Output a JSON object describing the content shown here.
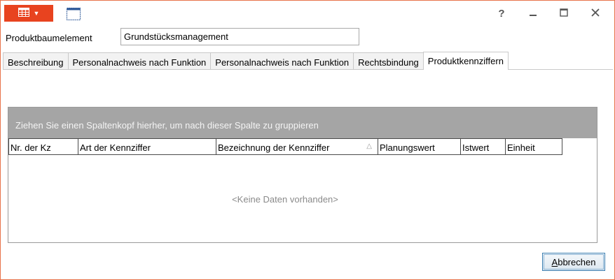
{
  "window": {
    "help_label": "?",
    "accent_color": "#e8431f"
  },
  "icons": {
    "app_menu": "grid-icon",
    "app_menu_caret": "caret-down-icon",
    "layout": "window-layout-icon",
    "minimize": "minimize-icon",
    "maximize": "maximize-icon",
    "close": "close-icon",
    "sort": "sort-ascending-icon"
  },
  "field": {
    "label": "Produktbaumelement",
    "value": "Grundstücksmanagement"
  },
  "tabs": [
    {
      "label": "Beschreibung",
      "active": false
    },
    {
      "label": "Personalnachweis nach Funktion",
      "active": false
    },
    {
      "label": "Personalnachweis nach Funktion",
      "active": false
    },
    {
      "label": "Rechtsbindung",
      "active": false
    },
    {
      "label": "Produktkennziffern",
      "active": true
    }
  ],
  "grid": {
    "group_panel_text": "Ziehen Sie einen Spaltenkopf hierher, um nach dieser Spalte zu gruppieren",
    "columns": [
      {
        "label": "Nr. der Kz"
      },
      {
        "label": "Art der Kennziffer"
      },
      {
        "label": "Bezeichnung der Kennziffer",
        "sorted": "ascending",
        "sort_glyph": "△"
      },
      {
        "label": "Planungswert"
      },
      {
        "label": "Istwert"
      },
      {
        "label": "Einheit"
      }
    ],
    "empty_text": "<Keine Daten vorhanden>"
  },
  "buttons": {
    "cancel_accesskey": "A",
    "cancel_rest": "bbrechen"
  }
}
